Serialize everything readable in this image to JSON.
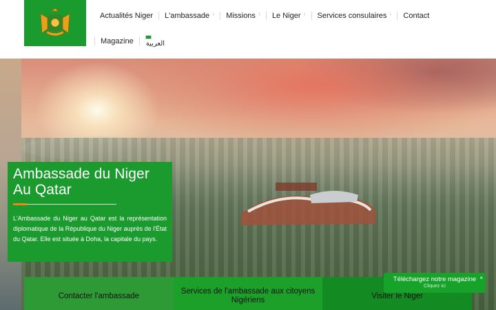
{
  "header": {
    "logo_icon": "niger-coat-of-arms-icon",
    "nav_row1": [
      {
        "label": "Actualités Niger",
        "has_caret": false
      },
      {
        "label": "L'ambassade",
        "has_caret": true
      },
      {
        "label": "Missions",
        "has_caret": true
      },
      {
        "label": "Le Niger",
        "has_caret": true
      },
      {
        "label": "Services consulaires",
        "has_caret": true
      },
      {
        "label": "Contact",
        "has_caret": false
      }
    ],
    "nav_row2": [
      {
        "label": "Magazine"
      },
      {
        "label": "العربية"
      }
    ],
    "caret": "↓"
  },
  "hero": {
    "title_line1": "Ambassade du Niger",
    "title_line2": "Au Qatar",
    "description": "L'Ambassade du Niger au Qatar est la représentation diplomatique de la République du Niger auprès de l'État du Qatar. Elle est située à Doha, la capitale du pays."
  },
  "bottom_bar": {
    "contact": "Contacter l'ambassade",
    "services": "Services de l'ambassade aux citoyens Nigériens",
    "visit": "Visiter le Niger"
  },
  "magazine_popup": {
    "title": "Téléchargez notre magazine",
    "subtitle": "Cliquez ici",
    "close": "×"
  },
  "colors": {
    "brand_green": "#1b9a2e",
    "accent_orange": "#e78a1a"
  }
}
